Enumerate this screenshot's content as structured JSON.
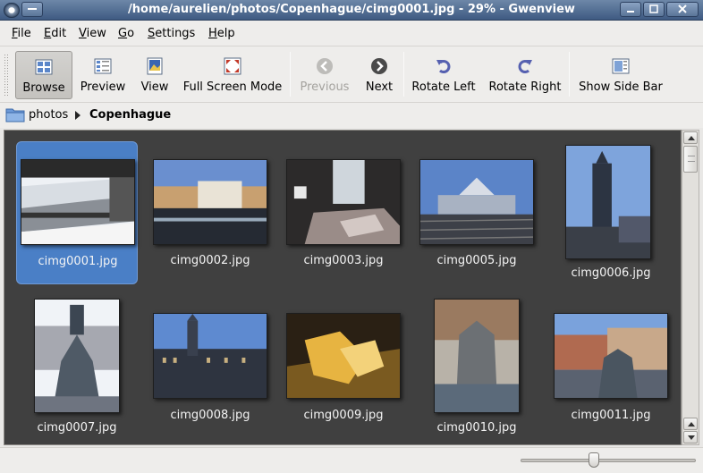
{
  "window": {
    "title": "/home/aurelien/photos/Copenhague/cimg0001.jpg - 29% - Gwenview"
  },
  "menu": [
    {
      "label": "File",
      "mnemonic": "F",
      "rest": "ile"
    },
    {
      "label": "Edit",
      "mnemonic": "E",
      "rest": "dit"
    },
    {
      "label": "View",
      "mnemonic": "V",
      "rest": "iew"
    },
    {
      "label": "Go",
      "mnemonic": "G",
      "rest": "o"
    },
    {
      "label": "Settings",
      "mnemonic": "S",
      "rest": "ettings"
    },
    {
      "label": "Help",
      "mnemonic": "H",
      "rest": "elp"
    }
  ],
  "toolbar": {
    "browse": "Browse",
    "preview": "Preview",
    "view": "View",
    "fullscreen": "Full Screen Mode",
    "previous": "Previous",
    "next": "Next",
    "rotate_left": "Rotate Left",
    "rotate_right": "Rotate Right",
    "show_sidebar": "Show Side Bar"
  },
  "breadcrumb": {
    "parent": "photos",
    "current": "Copenhague"
  },
  "thumbnails": [
    {
      "name": "cimg0001.jpg",
      "selected": true
    },
    {
      "name": "cimg0002.jpg",
      "selected": false
    },
    {
      "name": "cimg0003.jpg",
      "selected": false
    },
    {
      "name": "cimg0005.jpg",
      "selected": false
    },
    {
      "name": "cimg0006.jpg",
      "selected": false
    },
    {
      "name": "cimg0007.jpg",
      "selected": false
    },
    {
      "name": "cimg0008.jpg",
      "selected": false
    },
    {
      "name": "cimg0009.jpg",
      "selected": false
    },
    {
      "name": "cimg0010.jpg",
      "selected": false
    },
    {
      "name": "cimg0011.jpg",
      "selected": false
    }
  ],
  "colors": {
    "selection": "#4a7fc6",
    "view_background": "#404040",
    "titlebar": "#4f6b92"
  }
}
